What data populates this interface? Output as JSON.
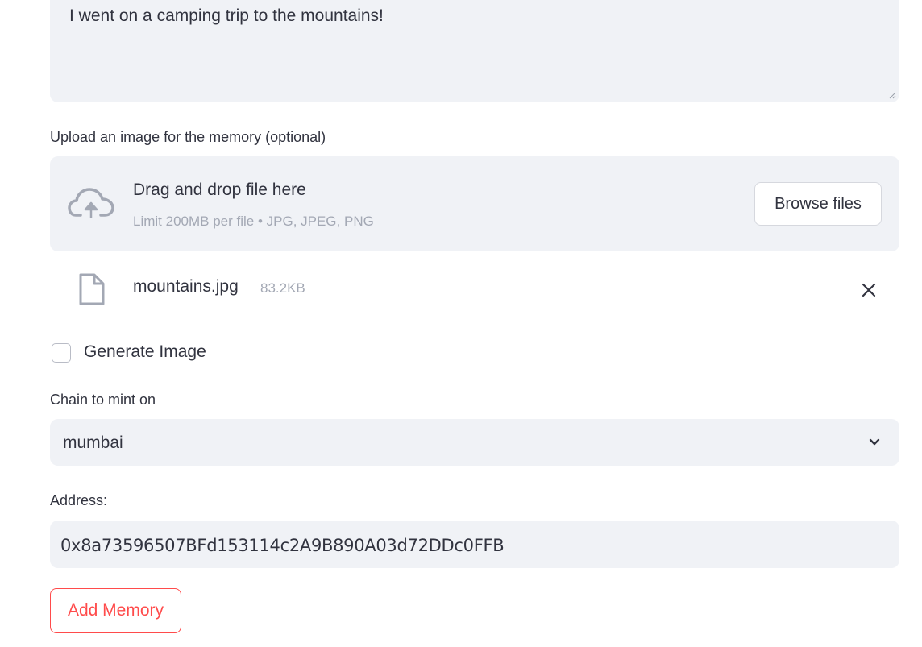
{
  "memory": {
    "text_value": "I went on a camping trip to the mountains!"
  },
  "upload": {
    "label": "Upload an image for the memory (optional)",
    "dropzone_title": "Drag and drop file here",
    "dropzone_limit": "Limit 200MB per file • JPG, JPEG, PNG",
    "browse_label": "Browse files",
    "file": {
      "name": "mountains.jpg",
      "size": "83.2KB"
    }
  },
  "generate_image": {
    "label": "Generate Image",
    "checked": false
  },
  "chain": {
    "label": "Chain to mint on",
    "selected": "mumbai"
  },
  "address": {
    "label": "Address:",
    "value": "0x8a73596507BFd153114c2A9B890A03d72DDc0FFB"
  },
  "actions": {
    "add_memory_label": "Add Memory"
  },
  "colors": {
    "field_bg": "#f0f2f6",
    "text": "#31333f",
    "muted": "#a3a8b4",
    "accent": "#ff4b4b"
  },
  "icons": {
    "upload": "cloud-upload-icon",
    "file": "file-icon",
    "remove": "close-icon",
    "dropdown": "chevron-down-icon"
  }
}
